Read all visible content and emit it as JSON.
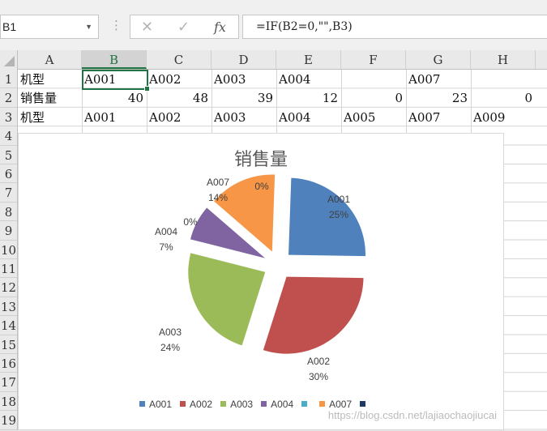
{
  "name_box": "B1",
  "formula_bar": {
    "cancel_icon": "✕",
    "enter_icon": "✓",
    "fx_label": "fx",
    "formula": "=IF(B2=0,\"\",B3)"
  },
  "columns": [
    "A",
    "B",
    "C",
    "D",
    "E",
    "F",
    "G",
    "H"
  ],
  "active_column": "B",
  "rows": [
    "1",
    "2",
    "3",
    "4",
    "5",
    "6",
    "7",
    "8",
    "9",
    "10",
    "11",
    "12",
    "13",
    "14",
    "15",
    "16",
    "17",
    "18",
    "19"
  ],
  "cells": {
    "row1": [
      "机型",
      "A001",
      "A002",
      "A003",
      "A004",
      "",
      "A007",
      ""
    ],
    "row2": [
      "销售量",
      "40",
      "48",
      "39",
      "12",
      "0",
      "23",
      "0"
    ],
    "row3": [
      "机型",
      "A001",
      "A002",
      "A003",
      "A004",
      "A005",
      "A007",
      "A009"
    ]
  },
  "chart": {
    "title": "销售量",
    "watermark": "https://blog.csdn.net/lajiaochaojiucai"
  },
  "chart_data": {
    "type": "pie",
    "title": "销售量",
    "exploded": true,
    "slices": [
      {
        "category": "A001",
        "value": 40,
        "percent_label": "25%",
        "color": "#4f81bd"
      },
      {
        "category": "A002",
        "value": 48,
        "percent_label": "30%",
        "color": "#c0504d"
      },
      {
        "category": "A003",
        "value": 39,
        "percent_label": "24%",
        "color": "#9bbb59"
      },
      {
        "category": "A004",
        "value": 12,
        "percent_label": "7%",
        "color": "#8064a2"
      },
      {
        "category": "",
        "value": 0,
        "percent_label": "0%",
        "color": "#4bacc6"
      },
      {
        "category": "A007",
        "value": 23,
        "percent_label": "14%",
        "color": "#f79646"
      },
      {
        "category": "",
        "value": 0,
        "percent_label": "0%",
        "color": "#1f3864"
      }
    ],
    "legend_position": "bottom"
  }
}
